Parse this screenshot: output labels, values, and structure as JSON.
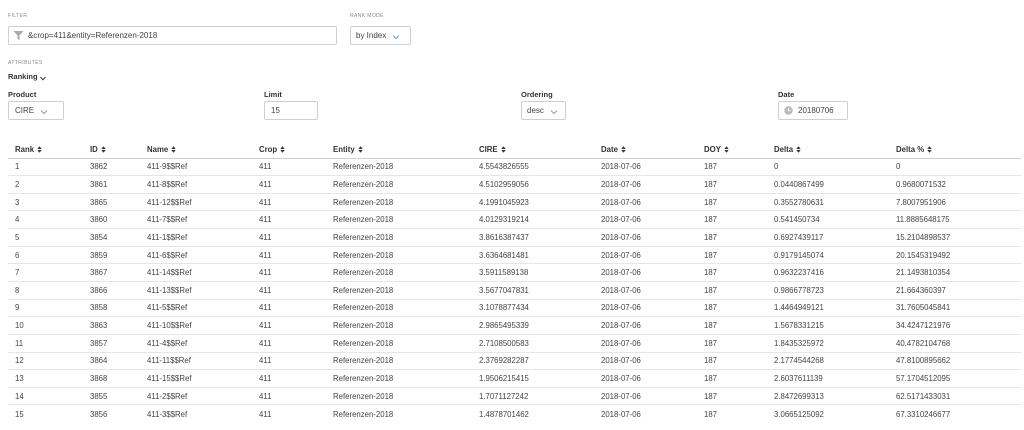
{
  "filter": {
    "label": "FILTER",
    "value": "&crop=411&entity=Referenzen-2018"
  },
  "rank_mode": {
    "label": "RANK MODE",
    "value": "by Index"
  },
  "attributes": {
    "label": "ATTRIBUTES",
    "ranking_toggle": "Ranking"
  },
  "product": {
    "label": "Product",
    "value": "CIRE"
  },
  "limit": {
    "label": "Limit",
    "value": "15"
  },
  "ordering": {
    "label": "Ordering",
    "value": "desc"
  },
  "date": {
    "label": "Date",
    "value": "20180706"
  },
  "table": {
    "headers": [
      "Rank",
      "ID",
      "Name",
      "Crop",
      "Entity",
      "CIRE",
      "Date",
      "DOY",
      "Delta",
      "Delta %"
    ],
    "rows": [
      [
        "1",
        "3862",
        "411-9$$Ref",
        "411",
        "Referenzen-2018",
        "4.5543826555",
        "2018-07-06",
        "187",
        "0",
        "0"
      ],
      [
        "2",
        "3861",
        "411-8$$Ref",
        "411",
        "Referenzen-2018",
        "4.5102959056",
        "2018-07-06",
        "187",
        "0.0440867499",
        "0.9680071532"
      ],
      [
        "3",
        "3865",
        "411-12$$Ref",
        "411",
        "Referenzen-2018",
        "4.1991045923",
        "2018-07-06",
        "187",
        "0.3552780631",
        "7.8007951906"
      ],
      [
        "4",
        "3860",
        "411-7$$Ref",
        "411",
        "Referenzen-2018",
        "4.0129319214",
        "2018-07-06",
        "187",
        "0.541450734",
        "11.8885648175"
      ],
      [
        "5",
        "3854",
        "411-1$$Ref",
        "411",
        "Referenzen-2018",
        "3.8616387437",
        "2018-07-06",
        "187",
        "0.6927439117",
        "15.2104898537"
      ],
      [
        "6",
        "3859",
        "411-6$$Ref",
        "411",
        "Referenzen-2018",
        "3.6364681481",
        "2018-07-06",
        "187",
        "0.9179145074",
        "20.1545319492"
      ],
      [
        "7",
        "3867",
        "411-14$$Ref",
        "411",
        "Referenzen-2018",
        "3.5911589138",
        "2018-07-06",
        "187",
        "0.9632237416",
        "21.1493810354"
      ],
      [
        "8",
        "3866",
        "411-13$$Ref",
        "411",
        "Referenzen-2018",
        "3.5677047831",
        "2018-07-06",
        "187",
        "0.9866778723",
        "21.664360397"
      ],
      [
        "9",
        "3858",
        "411-5$$Ref",
        "411",
        "Referenzen-2018",
        "3.1078877434",
        "2018-07-06",
        "187",
        "1.4464949121",
        "31.7605045841"
      ],
      [
        "10",
        "3863",
        "411-10$$Ref",
        "411",
        "Referenzen-2018",
        "2.9865495339",
        "2018-07-06",
        "187",
        "1.5678331215",
        "34.4247121976"
      ],
      [
        "11",
        "3857",
        "411-4$$Ref",
        "411",
        "Referenzen-2018",
        "2.7108500583",
        "2018-07-06",
        "187",
        "1.8435325972",
        "40.4782104768"
      ],
      [
        "12",
        "3864",
        "411-11$$Ref",
        "411",
        "Referenzen-2018",
        "2.3769282287",
        "2018-07-06",
        "187",
        "2.1774544268",
        "47.8100895662"
      ],
      [
        "13",
        "3868",
        "411-15$$Ref",
        "411",
        "Referenzen-2018",
        "1.9506215415",
        "2018-07-06",
        "187",
        "2.6037611139",
        "57.1704512095"
      ],
      [
        "14",
        "3855",
        "411-2$$Ref",
        "411",
        "Referenzen-2018",
        "1.7071127242",
        "2018-07-06",
        "187",
        "2.8472699313",
        "62.5171433031"
      ],
      [
        "15",
        "3856",
        "411-3$$Ref",
        "411",
        "Referenzen-2018",
        "1.4878701462",
        "2018-07-06",
        "187",
        "3.0665125092",
        "67.3310246677"
      ]
    ]
  },
  "icons": {
    "filter": "filter-funnel-icon",
    "dropdown": "chevron-down-icon",
    "date": "clock-icon",
    "sort": "sort-icon"
  },
  "colors": {
    "border": "#cfcfcf",
    "row_border": "#e6e6e6",
    "icon": "#999999"
  }
}
